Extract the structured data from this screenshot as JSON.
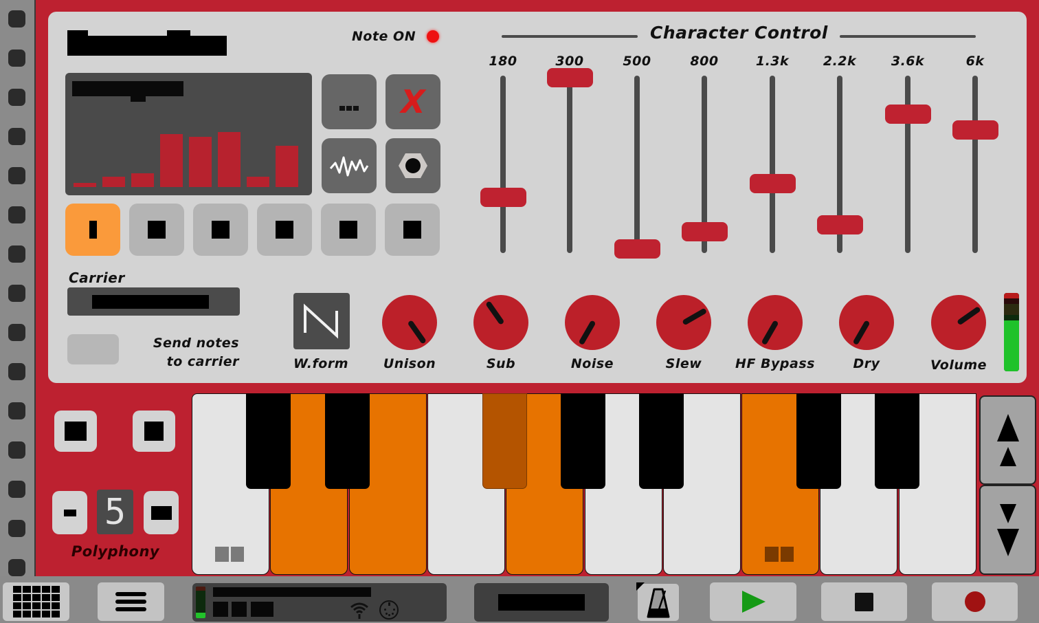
{
  "app": {
    "title": "[redacted]",
    "note_on_label": "Note ON",
    "note_on_active": true
  },
  "display": {
    "label": "[redacted]",
    "bar_levels": [
      0.08,
      0.19,
      0.25,
      0.96,
      0.91,
      1.0,
      0.19,
      0.75
    ]
  },
  "panel_buttons": {
    "more_icon": "ellipsis-icon",
    "close_icon": "close-x-icon",
    "close_glyph": "X",
    "wave_icon": "waveform-icon",
    "nut_icon": "hex-nut-icon"
  },
  "preset_slots": [
    {
      "active": true
    },
    {
      "active": false
    },
    {
      "active": false
    },
    {
      "active": false
    },
    {
      "active": false
    },
    {
      "active": false
    }
  ],
  "carrier": {
    "label": "Carrier",
    "selected_value": "[redacted]",
    "send_notes_label_line1": "Send notes",
    "send_notes_label_line2": "to carrier",
    "send_notes_enabled": false
  },
  "character_control": {
    "title": "Character Control",
    "bands": [
      {
        "label": "180",
        "value": 0.31
      },
      {
        "label": "300",
        "value": 1.0
      },
      {
        "label": "500",
        "value": 0.01
      },
      {
        "label": "800",
        "value": 0.11
      },
      {
        "label": "1.3k",
        "value": 0.39
      },
      {
        "label": "2.2k",
        "value": 0.15
      },
      {
        "label": "3.6k",
        "value": 0.79
      },
      {
        "label": "6k",
        "value": 0.7
      }
    ]
  },
  "controls": {
    "waveform": {
      "label": "W.form",
      "icon": "sawtooth-wave-icon"
    },
    "knobs": [
      {
        "label": "Unison",
        "angle_deg": 145
      },
      {
        "label": "Sub",
        "angle_deg": -35
      },
      {
        "label": "Noise",
        "angle_deg": -150
      },
      {
        "label": "Slew",
        "angle_deg": 60
      },
      {
        "label": "HF Bypass",
        "angle_deg": -150
      },
      {
        "label": "Dry",
        "angle_deg": -150
      },
      {
        "label": "Volume",
        "angle_deg": 55
      }
    ],
    "output_level": 0.65
  },
  "polyphony": {
    "label": "Polyphony",
    "value": "5",
    "decrement_label": "-"
  },
  "keyboard": {
    "white_keys_on": [
      false,
      true,
      true,
      false,
      true,
      false,
      false,
      true,
      false,
      false
    ],
    "black_keys": [
      {
        "on": false
      },
      {
        "on": false
      },
      {
        "on": true
      },
      {
        "on": false
      },
      {
        "on": false
      },
      {
        "on": false
      },
      {
        "on": false
      }
    ],
    "octave_up_icon": "double-chevron-up-icon",
    "octave_down_icon": "double-chevron-down-icon"
  },
  "bottombar": {
    "grid_icon": "grid-icon",
    "menu_icon": "hamburger-menu-icon",
    "status_line1": "[redacted]",
    "status_line2": "[redacted]",
    "wifi_icon": "wifi-icon",
    "midi_icon": "midi-din-icon",
    "song_name": "[redacted]",
    "metronome_icon": "metronome-icon",
    "play_icon": "play-icon",
    "stop_icon": "stop-icon",
    "record_icon": "record-icon",
    "colors": {
      "play": "#159a15",
      "record": "#a01212",
      "stop": "#111111"
    }
  }
}
